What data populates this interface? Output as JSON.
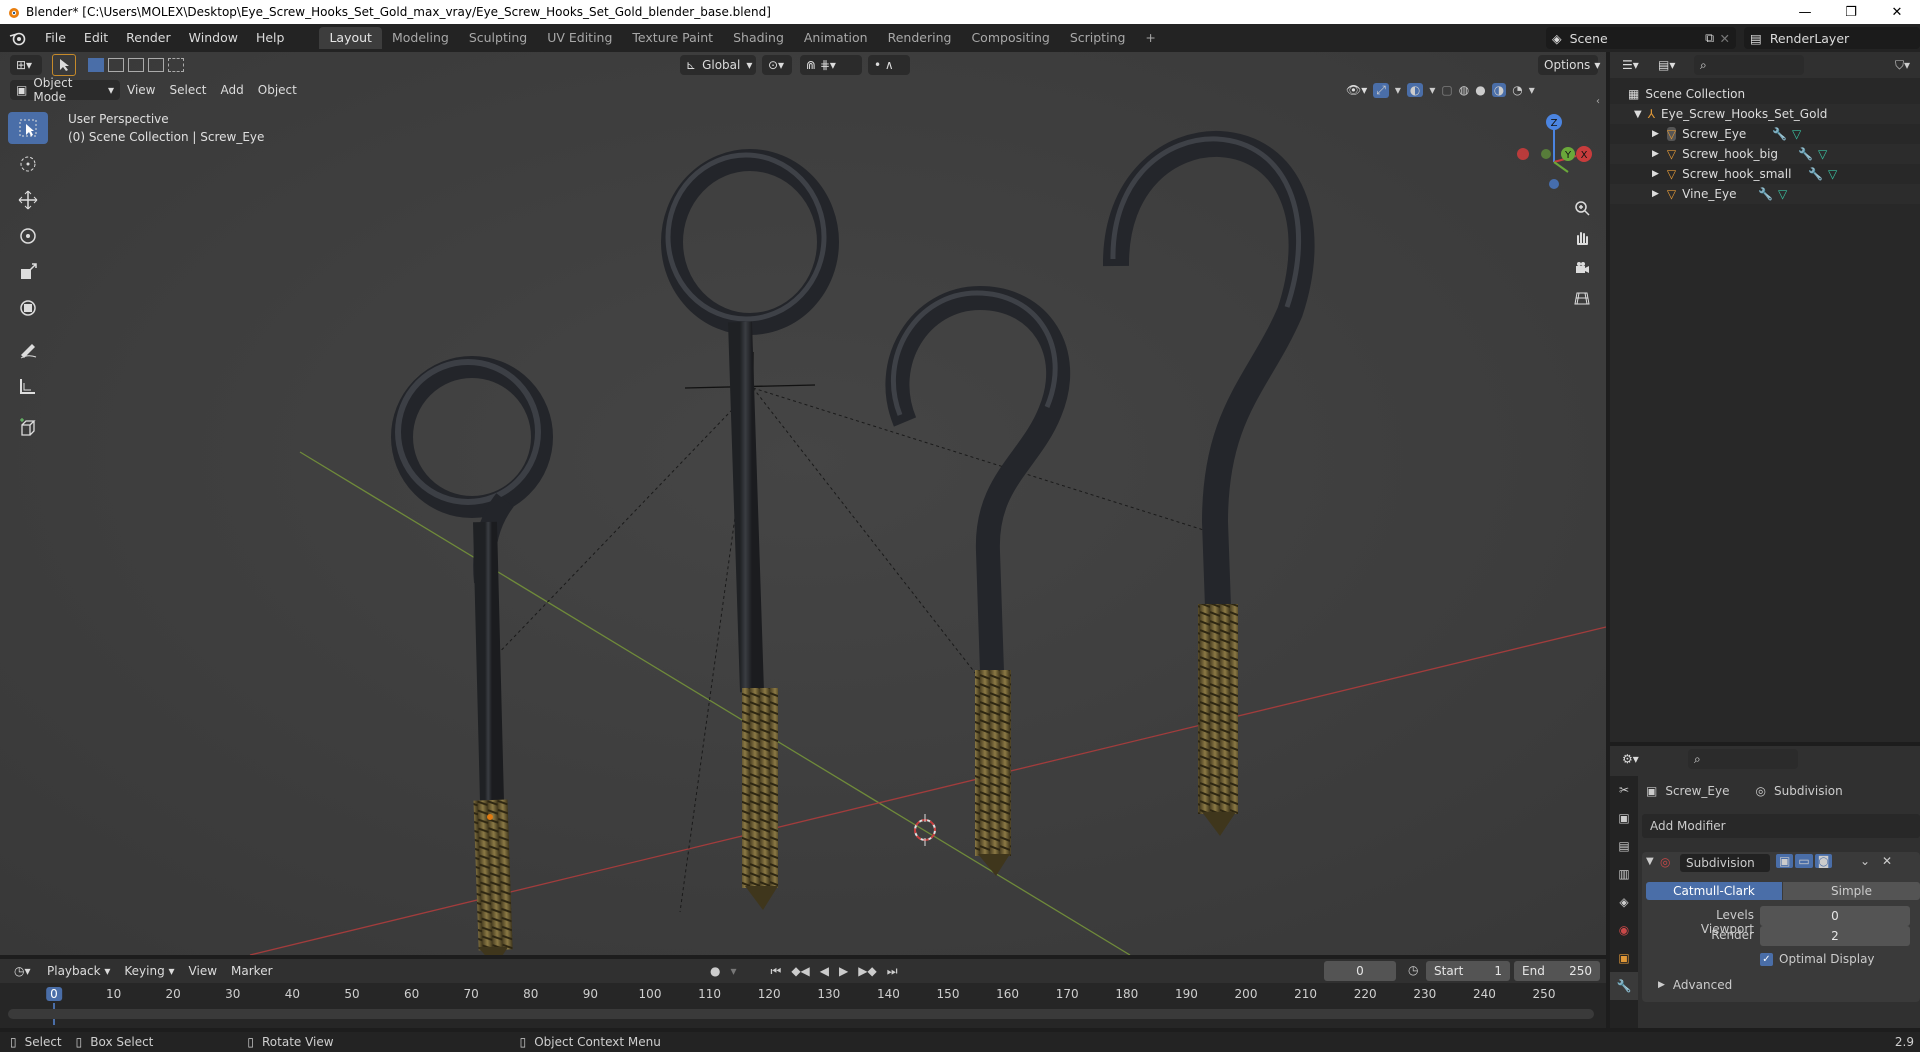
{
  "window": {
    "title": "Blender* [C:\\Users\\MOLEX\\Desktop\\Eye_Screw_Hooks_Set_Gold_max_vray/Eye_Screw_Hooks_Set_Gold_blender_base.blend]",
    "minimize": "—",
    "maximize": "❐",
    "close": "✕"
  },
  "menu": [
    "File",
    "Edit",
    "Render",
    "Window",
    "Help"
  ],
  "workspaces": [
    "Layout",
    "Modeling",
    "Sculpting",
    "UV Editing",
    "Texture Paint",
    "Shading",
    "Animation",
    "Rendering",
    "Compositing",
    "Scripting",
    "+"
  ],
  "scene": {
    "name": "Scene",
    "render_layer": "RenderLayer"
  },
  "viewport": {
    "mode": "Object Mode",
    "menus": [
      "View",
      "Select",
      "Add",
      "Object"
    ],
    "transform": "Global",
    "options": "Options",
    "info_line1": "User Perspective",
    "info_line2": "(0) Scene Collection | Screw_Eye",
    "gizmo": {
      "z": "Z",
      "y": "Y",
      "x": "X"
    }
  },
  "outliner": {
    "root": "Scene Collection",
    "collection": "Eye_Screw_Hooks_Set_Gold",
    "objects": [
      "Screw_Eye",
      "Screw_hook_big",
      "Screw_hook_small",
      "Vine_Eye"
    ]
  },
  "properties": {
    "object": "Screw_Eye",
    "modifier_tab": "Subdivision",
    "add_modifier": "Add Modifier",
    "modifier_name": "Subdivision",
    "type_a": "Catmull-Clark",
    "type_b": "Simple",
    "levels_label": "Levels Viewport",
    "levels_value": "0",
    "render_label": "Render",
    "render_value": "2",
    "optimal_display": "Optimal Display",
    "advanced": "Advanced"
  },
  "timeline": {
    "menus": [
      "Playback",
      "Keying",
      "View",
      "Marker"
    ],
    "current_frame": "0",
    "start_label": "Start",
    "start_value": "1",
    "end_label": "End",
    "end_value": "250",
    "ticks": [
      "0",
      "10",
      "20",
      "30",
      "40",
      "50",
      "60",
      "70",
      "80",
      "90",
      "100",
      "110",
      "120",
      "130",
      "140",
      "150",
      "160",
      "170",
      "180",
      "190",
      "200",
      "210",
      "220",
      "230",
      "240",
      "250"
    ],
    "cursor_frame": "0"
  },
  "statusbar": {
    "select": "Select",
    "box_select": "Box Select",
    "rotate_view": "Rotate View",
    "context_menu": "Object Context Menu",
    "version": "2.9"
  }
}
